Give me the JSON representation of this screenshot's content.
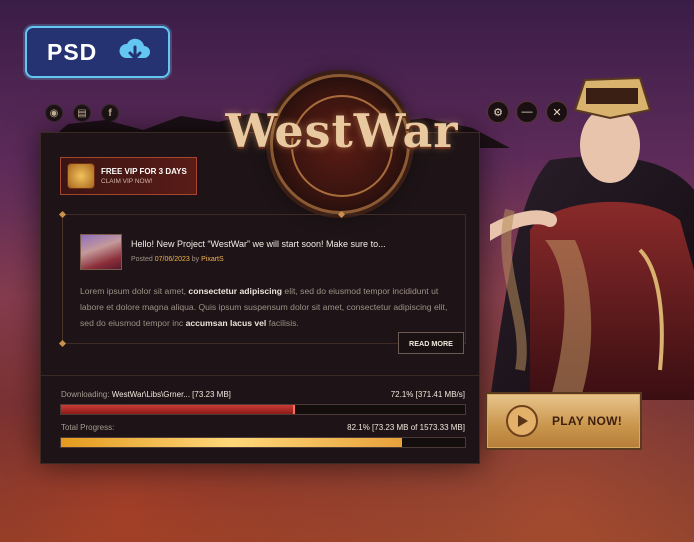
{
  "badge": {
    "label": "PSD",
    "icon": "cloud-download-icon"
  },
  "social": [
    {
      "name": "discord",
      "glyph": "◉"
    },
    {
      "name": "store",
      "glyph": "▤"
    },
    {
      "name": "facebook",
      "glyph": "f"
    }
  ],
  "window_controls": [
    {
      "name": "settings",
      "glyph": "⚙"
    },
    {
      "name": "minimize",
      "glyph": "—"
    },
    {
      "name": "close",
      "glyph": "✕"
    }
  ],
  "logo": {
    "title": "WestWar"
  },
  "vip": {
    "title": "FREE VIP FOR 3 DAYS",
    "subtitle": "CLAIM VIP NOW!"
  },
  "news": {
    "title": "Hello! New Project “WestWar” we will start soon! Make sure to...",
    "posted_prefix": "Posted",
    "date": "07/06/2023",
    "by": "by",
    "author": "PixartS",
    "body_1": "Lorem ipsum dolor sit amet,",
    "body_1b": "consectetur adipiscing",
    "body_2": "elit, sed do eiusmod tempor incididunt ut labore et dolore magna aliqua. Quis ipsum suspensum dolor sit amet, consectetur adipiscing elit, sed do eiusmod tempor inc",
    "body_2b": "accumsan lacus vel",
    "body_3": "facilisis.",
    "read_more": "READ MORE"
  },
  "download": {
    "label": "Downloading:",
    "path": "WestWar\\Libs\\Grner... [73.23 MB]",
    "progress_text": "72.1% [371.41 MB/s]",
    "progress": 0.58
  },
  "total": {
    "label": "Total Progress:",
    "progress_text": "82.1% [73.23 MB of 1573.33 MB]",
    "progress": 0.845
  },
  "play_button": {
    "label": "PLAY NOW!"
  },
  "colors": {
    "accent_gold": "#e8c48a",
    "accent_red": "#cc3b35",
    "badge_border": "#63c7f2"
  }
}
